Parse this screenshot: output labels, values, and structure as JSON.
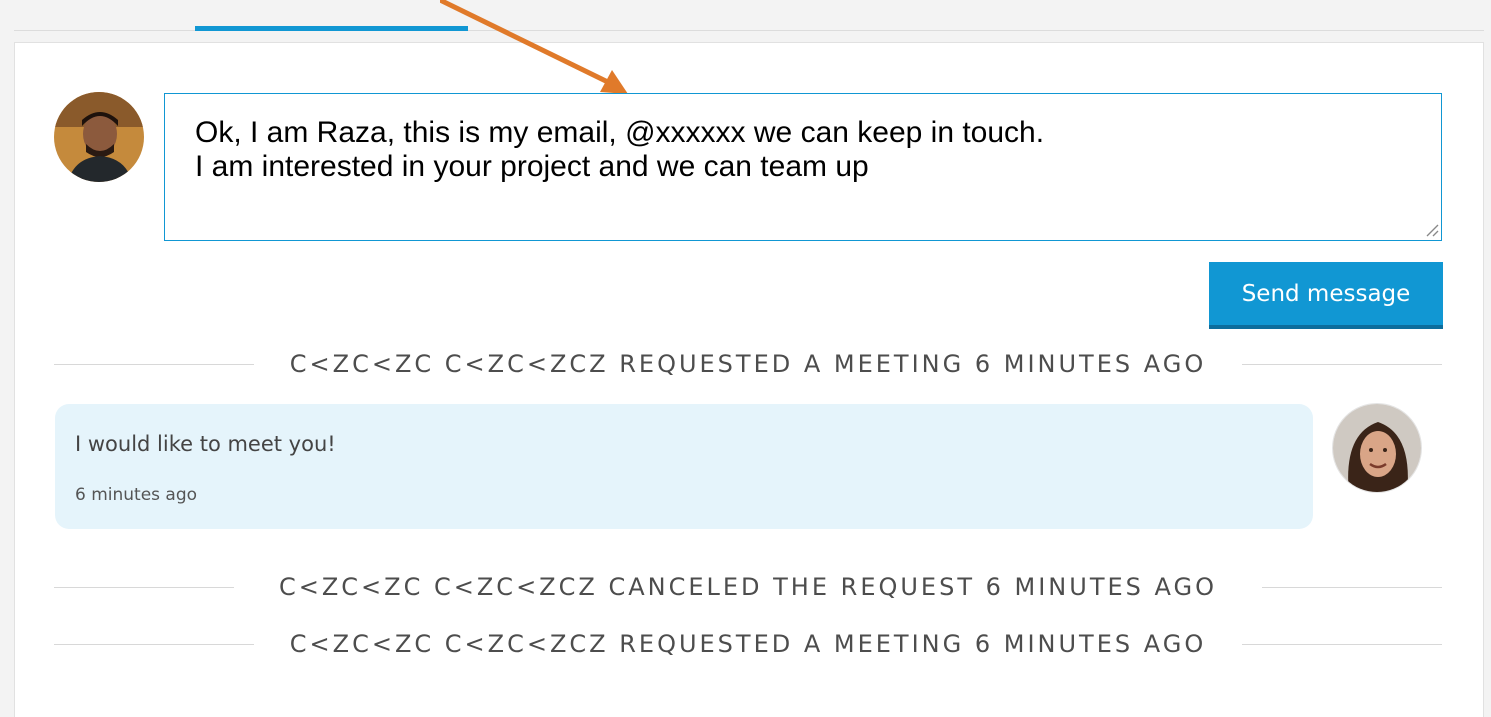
{
  "composer": {
    "value": "Ok, I am Raza, this is my email, @xxxxxx we can keep in touch.\nI am interested in your project and we can team up"
  },
  "send_button": {
    "label": "Send message"
  },
  "events": [
    {
      "text": "C<ZC<ZC C<ZC<ZCZ REQUESTED A MEETING 6 MINUTES AGO"
    },
    {
      "text": "C<ZC<ZC C<ZC<ZCZ CANCELED THE REQUEST 6 MINUTES AGO"
    },
    {
      "text": "C<ZC<ZC C<ZC<ZCZ REQUESTED A MEETING 6 MINUTES AGO"
    }
  ],
  "message": {
    "text": "I would like to meet you!",
    "time": "6 minutes ago"
  },
  "colors": {
    "accent": "#1197d3",
    "bubble": "#e5f4fb",
    "annotation_arrow": "#e07a2a"
  },
  "icons": {
    "composer_resize": "resize-grip-icon",
    "my_avatar": "avatar",
    "other_avatar": "avatar"
  }
}
